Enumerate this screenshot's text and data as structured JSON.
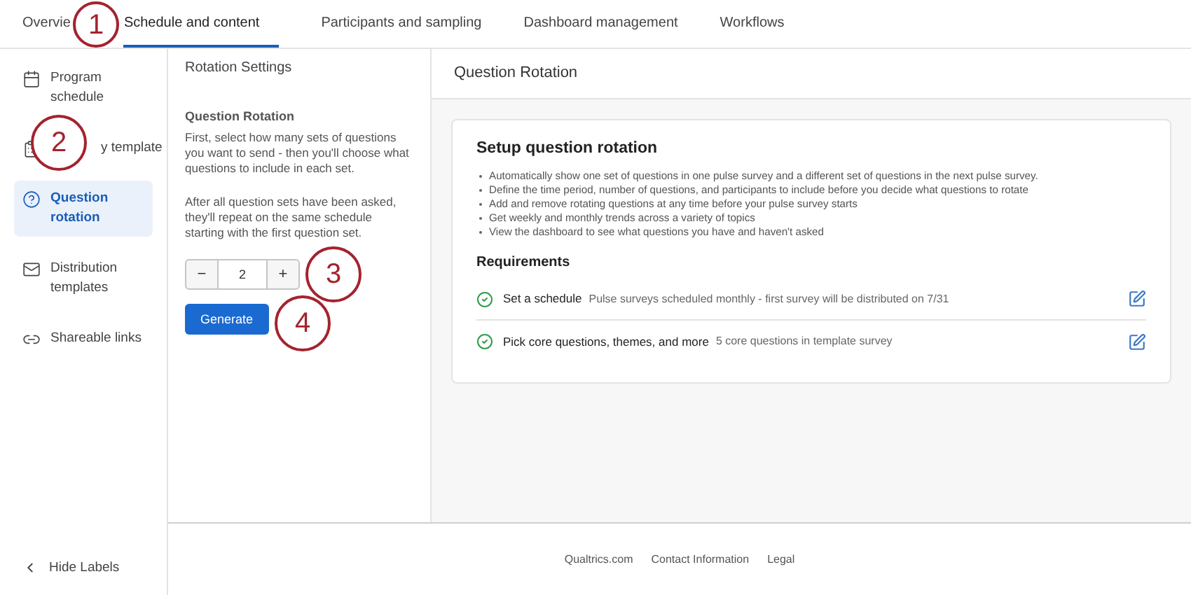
{
  "tabs": [
    {
      "label": "Overvie",
      "selected": false
    },
    {
      "label": "Schedule and content",
      "selected": true
    },
    {
      "label": "Participants and sampling",
      "selected": false
    },
    {
      "label": "Dashboard management",
      "selected": false
    },
    {
      "label": "Workflows",
      "selected": false
    }
  ],
  "sidebar": {
    "items": [
      {
        "label": "Program schedule",
        "selected": false
      },
      {
        "label": "y template",
        "selected": false
      },
      {
        "label": "Question rotation",
        "selected": true
      },
      {
        "label": "Distribution templates",
        "selected": false
      },
      {
        "label": "Shareable links",
        "selected": false
      }
    ],
    "hide_labels": "Hide Labels"
  },
  "settings": {
    "title": "Rotation Settings",
    "heading": "Question Rotation",
    "paragraphs": [
      "First, select how many sets of questions you want to send - then you'll choose what questions to include in each set.",
      "After all question sets have been asked, they'll repeat on the same schedule starting with the first question set."
    ],
    "stepper": {
      "minus": "−",
      "value": "2",
      "plus": "+"
    },
    "button": "Generate"
  },
  "main": {
    "title": "Question Rotation",
    "card": {
      "title": "Setup question rotation",
      "bullets": [
        "Automatically show one set of questions in one pulse survey and a different set of questions in the next pulse survey.",
        "Define the time period, number of questions, and participants to include before you decide what questions to rotate",
        "Add and remove rotating questions at any time before your pulse survey starts",
        "Get weekly and monthly trends across a variety of topics",
        "View the dashboard to see what questions you have and haven't asked"
      ],
      "requirements_title": "Requirements",
      "requirements": [
        {
          "label": "Set a schedule",
          "detail": "Pulse surveys scheduled monthly - first survey will be distributed on 7/31",
          "done": true
        },
        {
          "label": "Pick core questions, themes, and more",
          "detail": "5 core questions in template survey",
          "done": true
        }
      ]
    }
  },
  "footer": [
    "Qualtrics.com",
    "Contact Information",
    "Legal"
  ],
  "callouts": [
    "1",
    "2",
    "3",
    "4"
  ]
}
